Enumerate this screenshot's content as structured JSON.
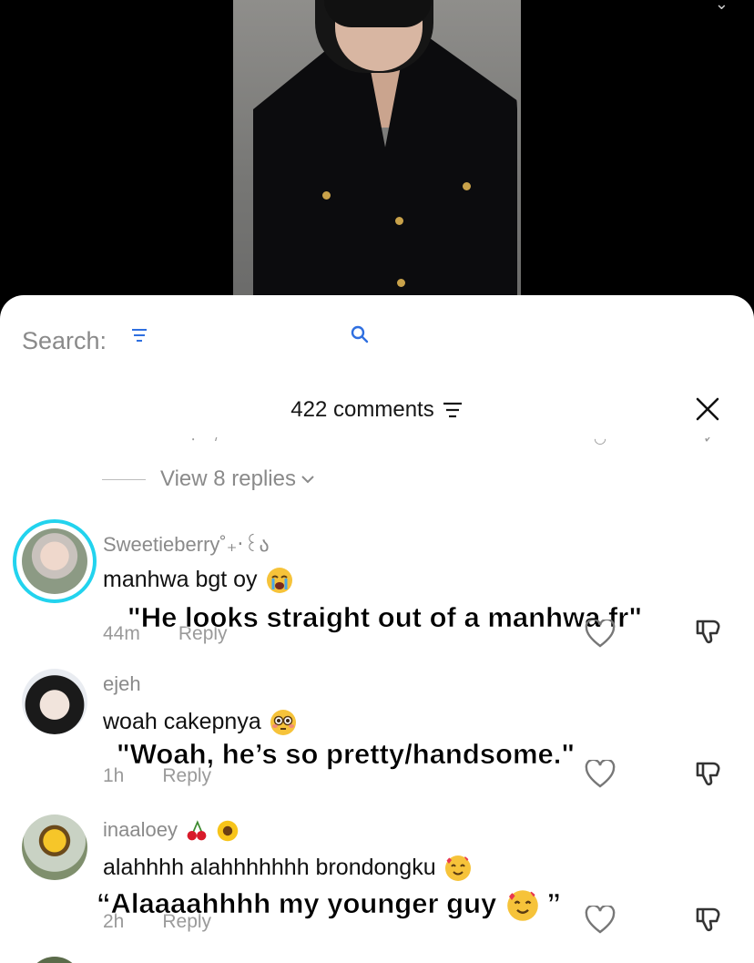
{
  "sheet": {
    "search_label": "Search:",
    "comment_count": "422 comments",
    "view_replies": "View 8 replies"
  },
  "comments": [
    {
      "username": "Sweetieberry˚₊‧꒰ა",
      "text": "manhwa bgt oy",
      "emoji": "loudly-crying-face",
      "time": "44m",
      "reply": "Reply",
      "caption": "\"He looks straight out of a manhwa fr\""
    },
    {
      "username": "ejeh",
      "text": "woah cakepnya",
      "emoji": "flushed-face",
      "time": "1h",
      "reply": "Reply",
      "caption": "\"Woah, he’s so pretty/handsome.\""
    },
    {
      "username": "inaaloey",
      "username_emojis": [
        "cherries",
        "sunflower"
      ],
      "text": "alahhhh alahhhhhhh brondongku",
      "emoji": "smiling-face-with-hearts",
      "time": "2h",
      "reply": "Reply",
      "caption": "“Alaaaahhhh my younger guy",
      "caption_emoji": "smiling-face-with-hearts",
      "caption_end": "”"
    }
  ],
  "colors": {
    "accent_ring": "#22d3ee",
    "muted_text": "#8a8a8a",
    "background": "#ffffff"
  }
}
